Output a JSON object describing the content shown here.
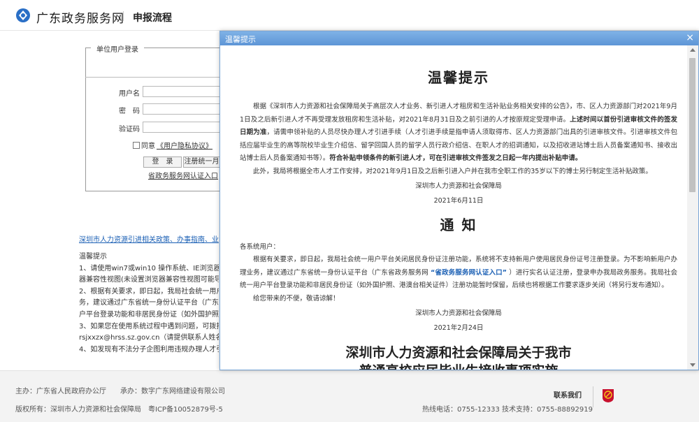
{
  "header": {
    "site_name": "广东政务服务网",
    "page_title": "申报流程",
    "logo_icon": "gd-gov-logo-icon",
    "brand_color": "#2a6fc6"
  },
  "login": {
    "legend": "单位用户登录",
    "username_label": "用户名",
    "password_label": "密　码",
    "captcha_label": "验证码",
    "agree_prefix": "同意",
    "privacy_link": "《用户隐私协议》",
    "login_button": "登　录",
    "register_button": "注册统一月",
    "gov_auth_link": "省政务服务网认证入口"
  },
  "left": {
    "policy_link": "深圳市人力资源引进相关政策、办事指南、业",
    "tips_title": "温馨提示",
    "tips_lines": [
      "1、请使用win7或win10 操作系统、IE浏览器（",
      "器兼容性视图(未设置浏览器兼容性视图可能导",
      "2、根据有关要求，即日起，我局社会统一用户",
      "务，建议通过广东省统一身份认证平台（广东",
      "户平台登录功能和非居民身份证（如外国护照",
      "3、如果您在使用系统过程中遇到问题，可拨打",
      "rsjxxzx@hrss.sz.gov.cn（请提供联系人姓名、",
      "4、如发现有不法分子企图利用违规办理人才引"
    ]
  },
  "footer": {
    "host": "主办：广东省人民政府办公厅",
    "operator": "承办：数字广东网络建设有限公司",
    "copyright": "版权所有：深圳市人力资源和社会保障局",
    "icp": "粤ICP备10052879号-5",
    "contact_title": "联系我们",
    "phone": "热线电话：0755-12333 技术支持：0755-88892919",
    "emblem_icon": "party-emblem-icon"
  },
  "modal": {
    "title": "温馨提示",
    "close": "×",
    "notice1": {
      "heading": "温馨提示",
      "p1_normal": "根据《深圳市人力资源和社会保障局关于高层次人才业务、新引进人才租房和生活补贴业务相关安排的公告》，市、区人力资源部门对2021年9月1日及之后新引进人才不再受理发放租房和生活补贴，对2021年8月31日及之前引进的人才按原规定受理申请。",
      "p1_bold": "上述时间以首份引进审核文件的签发日期为准",
      "p1_rest": "，请需申领补贴的人员尽快办理人才引进手续（人才引进手续是指申请人须取得市、区人力资源部门出具的引进审核文件。引进审核文件包括应届毕业生的高等院校毕业生介绍信、留学回国人员的留学人员行政介绍信、在职人才的招调通知，以及招收进站博士后人员备案通知书、接收出站博士后人员备案通知书等）。",
      "p1_bold2": "符合补贴申领条件的新引进人才，可在引进审核文件签发之日起一年内提出补贴申请。",
      "p2": "此外，我局将根据全市人才工作安排，对2021年9月1日及之后新引进入户并在我市全职工作的35岁以下的博士另行制定生活补贴政策。",
      "signer": "深圳市人力资源和社会保障局",
      "date": "2021年6月11日"
    },
    "notice2": {
      "heading": "通 知",
      "salutation": "各系统用户：",
      "p1_a": "根据有关要求，即日起，我局社会统一用户平台关闭居民身份证注册功能，系统将不支持新用户使用居民身份证号注册登录。为不影响新用户办理业务，建议通过广东省统一身份认证平台（广东省政务服务网 ",
      "p1_link": "“省政务服务网认证入口”",
      "p1_b": " ）进行实名认证注册，登录申办我局政务服务。我局社会统一用户平台登录功能和非居民身份证（如外国护照、港澳台相关证件）注册功能暂时保留，后续也将根据工作要求逐步关闭（将另行发布通知）。",
      "p2": "给您带来的不便，敬请谅解！",
      "signer": "深圳市人力资源和社会保障局",
      "date": "2021年2月24日"
    },
    "notice3": {
      "heading_line1": "深圳市人力资源和社会保障局关于我市",
      "heading_line2": "普通高校应届毕业生接收事项实施"
    }
  }
}
